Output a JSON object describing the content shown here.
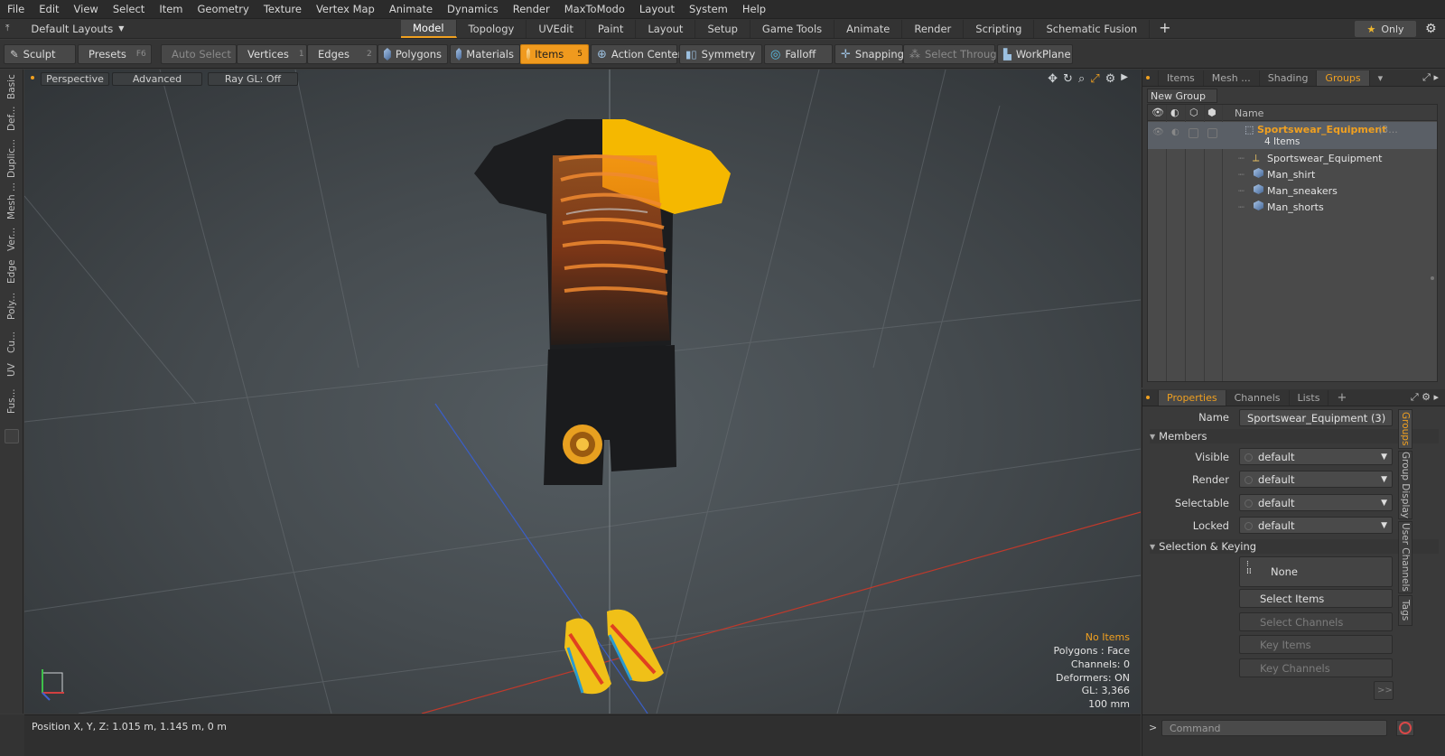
{
  "menu": [
    "File",
    "Edit",
    "View",
    "Select",
    "Item",
    "Geometry",
    "Texture",
    "Vertex Map",
    "Animate",
    "Dynamics",
    "Render",
    "MaxToModo",
    "Layout",
    "System",
    "Help"
  ],
  "layout_dropdown": "Default Layouts",
  "mode_tabs": [
    "Model",
    "Topology",
    "UVEdit",
    "Paint",
    "Layout",
    "Setup",
    "Game Tools",
    "Animate",
    "Render",
    "Scripting",
    "Schematic Fusion"
  ],
  "active_mode_tab": "Model",
  "only_button": "Only",
  "toolbar": {
    "sculpt": "Sculpt",
    "presets": "Presets",
    "presets_hotkey": "F6",
    "auto_select": "Auto Select",
    "vertices": "Vertices",
    "vertices_hotkey": "1",
    "edges": "Edges",
    "edges_hotkey": "2",
    "polygons": "Polygons",
    "materials": "Materials",
    "items": "Items",
    "items_hotkey": "5",
    "action_center": "Action Center",
    "symmetry": "Symmetry",
    "falloff": "Falloff",
    "snapping": "Snapping",
    "select_through": "Select Through",
    "workplane": "WorkPlane"
  },
  "left_tabs": [
    "Basic",
    "Def...",
    "Duplic...",
    "Mesh ...",
    "Ver...",
    "Edge",
    "Poly...",
    "Cu...",
    "UV",
    "Fus..."
  ],
  "viewport": {
    "view_mode": "Perspective",
    "shading": "Advanced",
    "raygl": "Ray GL: Off",
    "info": {
      "selection": "No Items",
      "polygons": "Polygons : Face",
      "channels": "Channels: 0",
      "deformers": "Deformers: ON",
      "gl": "GL: 3,366",
      "scale": "100 mm"
    }
  },
  "groups_panel": {
    "tabs": [
      "Items",
      "Mesh ...",
      "Shading",
      "Groups"
    ],
    "active_tab": "Groups",
    "new_group": "New Group",
    "name_header": "Name",
    "group_name": "Sportswear_Equipment",
    "group_suffix": "(3...",
    "group_count": "4 Items",
    "members": [
      "Sportswear_Equipment",
      "Man_shirt",
      "Man_sneakers",
      "Man_shorts"
    ]
  },
  "properties_panel": {
    "tabs": [
      "Properties",
      "Channels",
      "Lists"
    ],
    "active_tab": "Properties",
    "name_label": "Name",
    "name_value": "Sportswear_Equipment (3)",
    "members_section": "Members",
    "visible_label": "Visible",
    "visible_value": "default",
    "render_label": "Render",
    "render_value": "default",
    "selectable_label": "Selectable",
    "selectable_value": "default",
    "locked_label": "Locked",
    "locked_value": "default",
    "selection_section": "Selection & Keying",
    "none_button": "None",
    "select_items": "Select Items",
    "select_channels": "Select Channels",
    "key_items": "Key Items",
    "key_channels": "Key Channels",
    "more": ">>",
    "side_tabs": [
      "Groups",
      "Group Display",
      "User Channels",
      "Tags"
    ]
  },
  "status": {
    "position": "Position X, Y, Z:   1.015 m,  1.145 m,  0 m"
  },
  "command": {
    "prompt": ">",
    "placeholder": "Command"
  },
  "colors": {
    "accent": "#f0a020",
    "shirt_yellow": "#f5b800",
    "x_axis": "#c0392b",
    "z_axis": "#3a5ec8"
  }
}
